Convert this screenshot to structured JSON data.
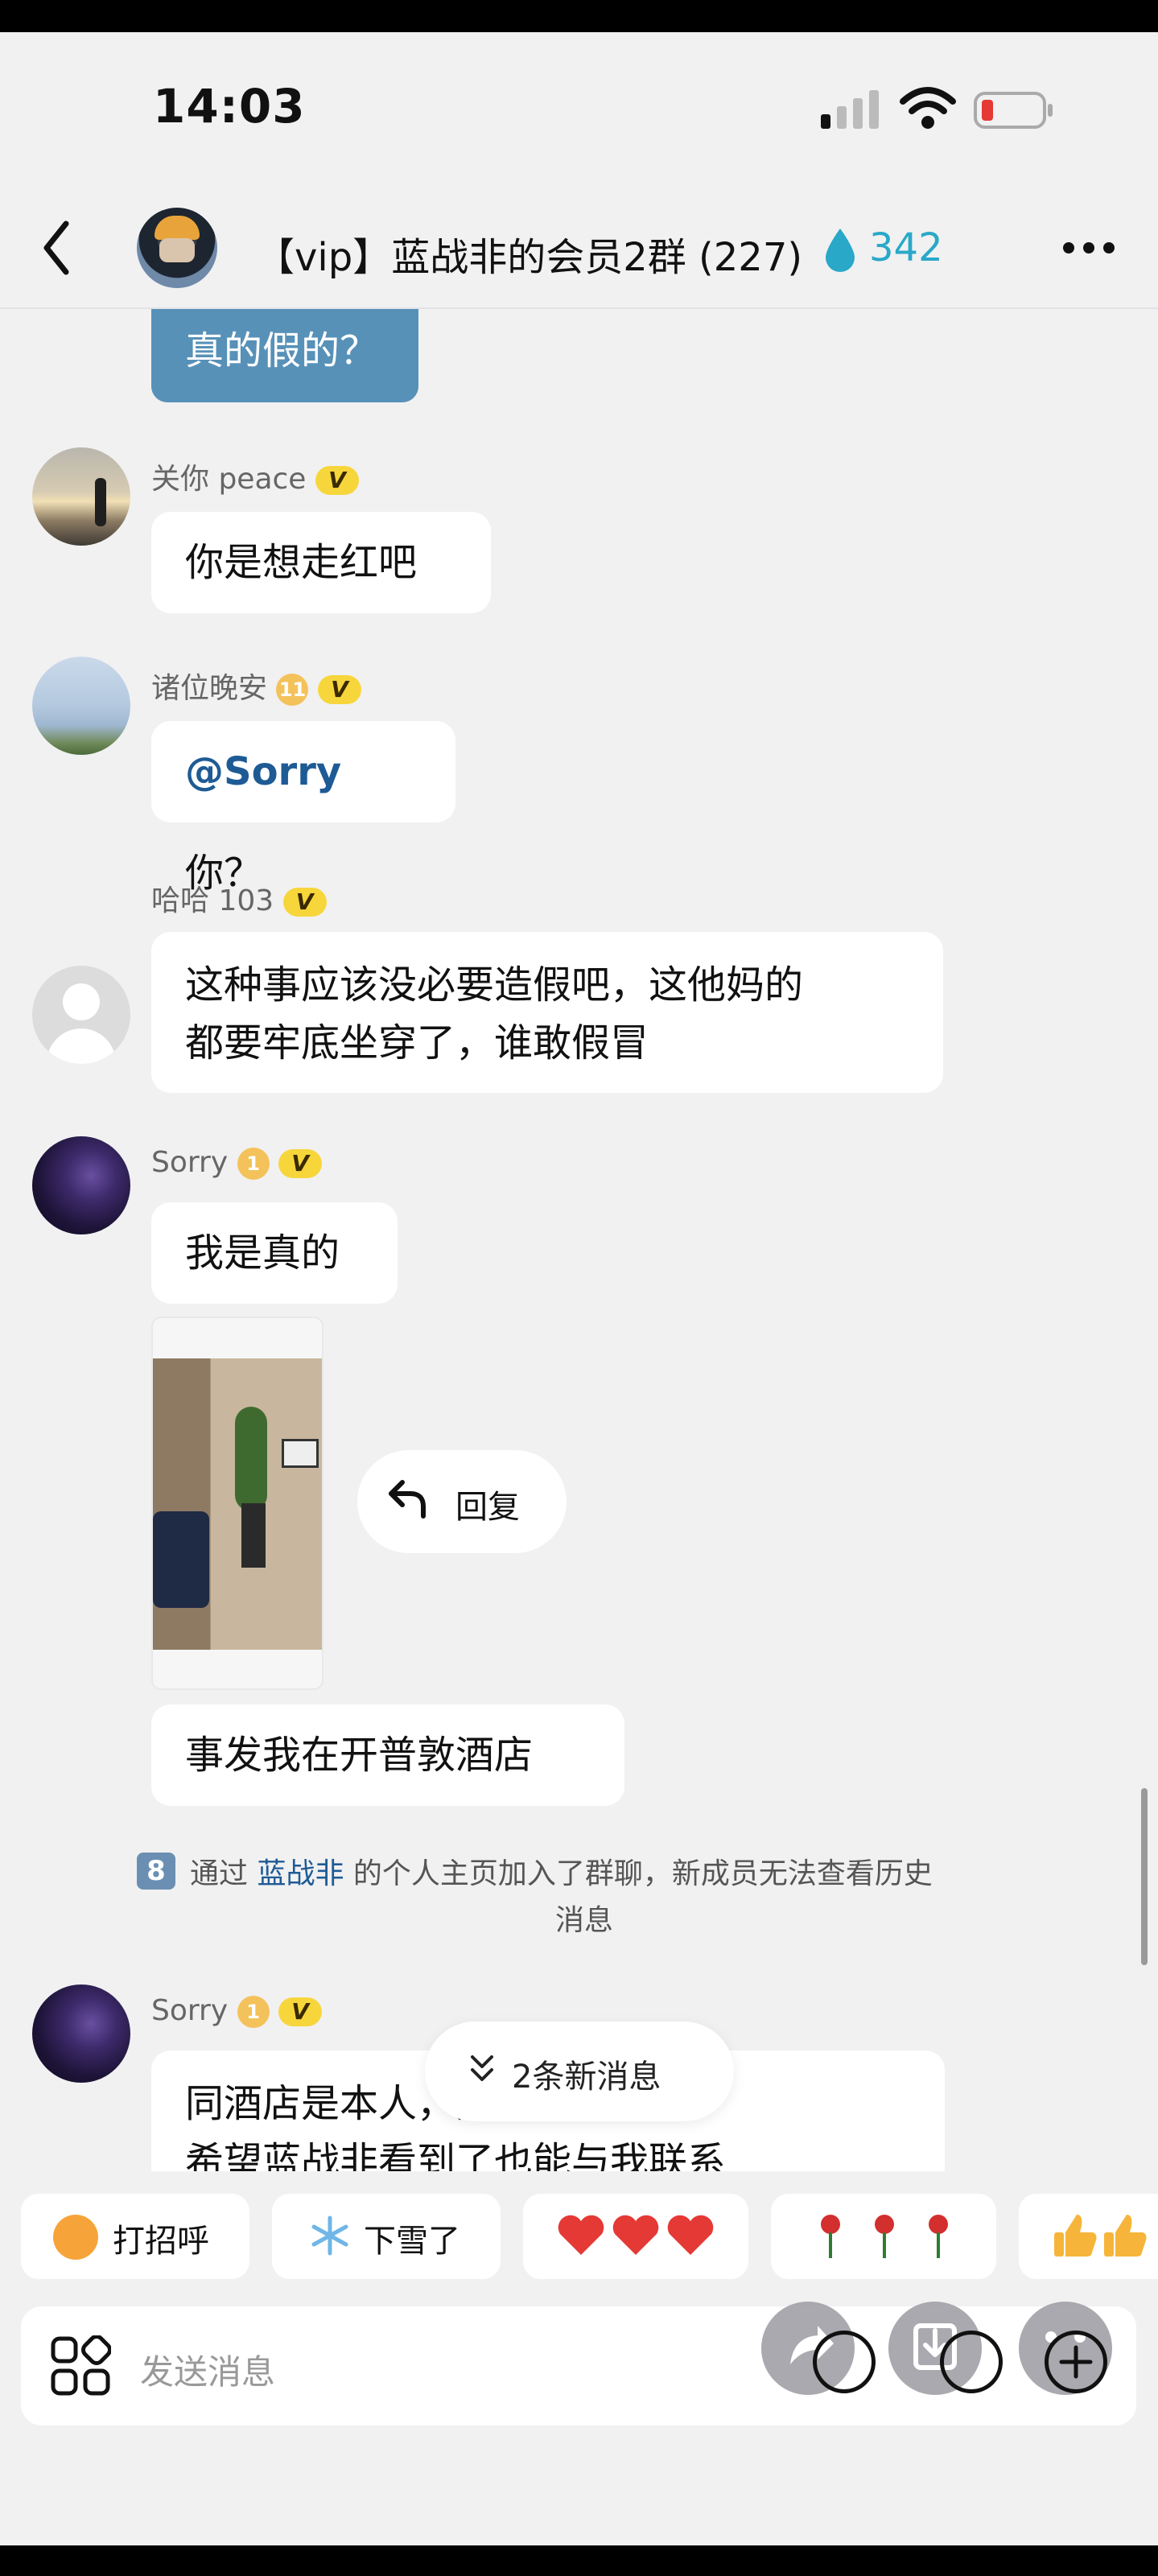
{
  "status_bar": {
    "time": "14:03"
  },
  "header": {
    "title": "【vip】蓝战非的会员2群 (227)",
    "count": "342"
  },
  "messages": {
    "m0": {
      "text": "真的假的？"
    },
    "m1": {
      "name": "关你 peace",
      "badge": "V",
      "text": "你是想走红吧"
    },
    "m2": {
      "name": "诸位晚安",
      "level": "11",
      "badge": "V",
      "mention": "@Sorry",
      "text": " 你？"
    },
    "m3": {
      "name": "哈哈 103",
      "badge": "V",
      "line1": "这种事应该没必要造假吧，这他妈的",
      "line2": "都要牢底坐穿了，谁敢假冒"
    },
    "m4": {
      "name": "Sorry",
      "level": "1",
      "badge": "V",
      "text": "我是真的",
      "reply_label": "回复",
      "text2": "事发我在开普敦酒店"
    },
    "system": {
      "num": "8",
      "prefix": "通过 ",
      "link": "蓝战非",
      "suffix": " 的个人主页加入了群聊，新成员无法查看历史",
      "line2": "消息"
    },
    "m5": {
      "name": "Sorry",
      "level": "1",
      "badge": "V",
      "line1": "同酒店是本人，只是行程有差。",
      "line2": "希望蓝战非看到了也能与我联系"
    }
  },
  "new_messages": {
    "label": "2条新消息"
  },
  "quick_chips": [
    {
      "icon": "smile-emoji",
      "label": "打招呼"
    },
    {
      "icon": "snowflake-emoji",
      "label": "下雪了"
    },
    {
      "icon": "hearts-emoji",
      "label": ""
    },
    {
      "icon": "roses-emoji",
      "label": ""
    },
    {
      "icon": "thumbs-up-emoji",
      "label": ""
    }
  ],
  "input": {
    "placeholder": "发送消息"
  },
  "colors": {
    "accent": "#2aa8c8",
    "mention": "#1e5b95",
    "bubble_blue": "#5791b8",
    "badge_yellow": "#f7d63c",
    "background": "#f1f1f2"
  }
}
